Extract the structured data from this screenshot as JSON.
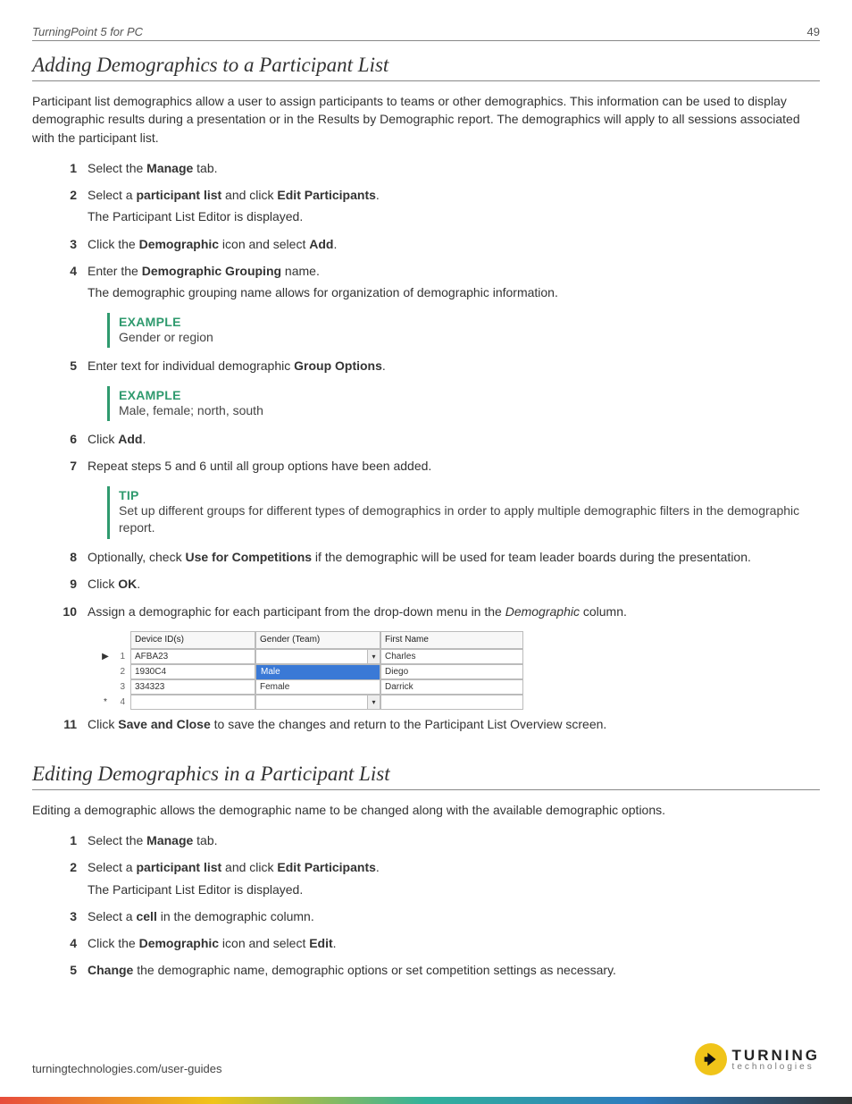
{
  "header": {
    "title": "TurningPoint 5 for PC",
    "page": "49"
  },
  "section1": {
    "title": "Adding Demographics to a Participant List",
    "intro": "Participant list demographics allow a user to assign participants to teams or other demographics. This information can be used to display demographic results during a presentation or in the Results by Demographic report. The demographics will apply to all sessions associated with the participant list.",
    "steps": [
      {
        "num": "1",
        "parts": [
          "Select the ",
          {
            "b": "Manage"
          },
          " tab."
        ]
      },
      {
        "num": "2",
        "parts": [
          "Select a ",
          {
            "b": "participant list"
          },
          " and click ",
          {
            "b": "Edit Participants"
          },
          "."
        ],
        "sub": "The Participant List Editor is displayed."
      },
      {
        "num": "3",
        "parts": [
          "Click the ",
          {
            "b": "Demographic"
          },
          " icon and select ",
          {
            "b": "Add"
          },
          "."
        ]
      },
      {
        "num": "4",
        "parts": [
          "Enter the ",
          {
            "b": "Demographic Grouping"
          },
          " name."
        ],
        "sub": "The demographic grouping name allows for organization of demographic information.",
        "callout": {
          "label": "EXAMPLE",
          "text": "Gender or region"
        }
      },
      {
        "num": "5",
        "parts": [
          "Enter text for individual demographic ",
          {
            "b": "Group Options"
          },
          "."
        ],
        "callout": {
          "label": "EXAMPLE",
          "text": "Male, female; north, south"
        }
      },
      {
        "num": "6",
        "parts": [
          "Click ",
          {
            "b": "Add"
          },
          "."
        ]
      },
      {
        "num": "7",
        "parts": [
          "Repeat steps 5 and 6 until all group options have been added."
        ],
        "callout": {
          "label": "TIP",
          "text": "Set up different groups for different types of demographics in order to apply multiple demographic filters in the demographic report."
        }
      },
      {
        "num": "8",
        "parts": [
          "Optionally, check ",
          {
            "b": "Use for Competitions"
          },
          " if the demographic will be used for team leader boards during the presentation."
        ]
      },
      {
        "num": "9",
        "parts": [
          "Click ",
          {
            "b": "OK"
          },
          "."
        ]
      },
      {
        "num": "10",
        "parts": [
          "Assign a demographic for each participant from the drop-down menu in the ",
          {
            "i": "Demographic"
          },
          " column."
        ]
      },
      {
        "num": "11",
        "parts": [
          "Click ",
          {
            "b": "Save and Close"
          },
          " to save the changes and return to the Participant List Overview screen."
        ]
      }
    ]
  },
  "screenshot": {
    "cols": {
      "device": "Device ID(s)",
      "gender": "Gender (Team)",
      "fname": "First Name"
    },
    "rows": [
      {
        "n": "1",
        "marker": "▶",
        "dev": "AFBA23",
        "gen": "",
        "fn": "Charles",
        "dd": true
      },
      {
        "n": "2",
        "marker": "",
        "dev": "1930C4",
        "gen": "",
        "fn": "Diego",
        "hl": "Male"
      },
      {
        "n": "3",
        "marker": "",
        "dev": "334323",
        "gen": "Female",
        "fn": "Darrick"
      },
      {
        "n": "4",
        "marker": "*",
        "dev": "",
        "gen": "",
        "fn": "",
        "dd": true
      }
    ]
  },
  "section2": {
    "title": "Editing Demographics in a Participant List",
    "intro": "Editing a demographic allows the demographic name to be changed along with the available demographic options.",
    "steps": [
      {
        "num": "1",
        "parts": [
          "Select the ",
          {
            "b": "Manage"
          },
          " tab."
        ]
      },
      {
        "num": "2",
        "parts": [
          "Select a ",
          {
            "b": "participant list"
          },
          " and click ",
          {
            "b": "Edit Participants"
          },
          "."
        ],
        "sub": "The Participant List Editor is displayed."
      },
      {
        "num": "3",
        "parts": [
          "Select a ",
          {
            "b": "cell"
          },
          " in the demographic column."
        ]
      },
      {
        "num": "4",
        "parts": [
          "Click the ",
          {
            "b": "Demographic"
          },
          " icon and select ",
          {
            "b": "Edit"
          },
          "."
        ]
      },
      {
        "num": "5",
        "parts": [
          {
            "b": "Change"
          },
          " the demographic name, demographic options or set competition settings as necessary."
        ]
      }
    ]
  },
  "footer": {
    "url": "turningtechnologies.com/user-guides",
    "logo": {
      "t1": "TURNING",
      "t2": "technologies"
    }
  }
}
